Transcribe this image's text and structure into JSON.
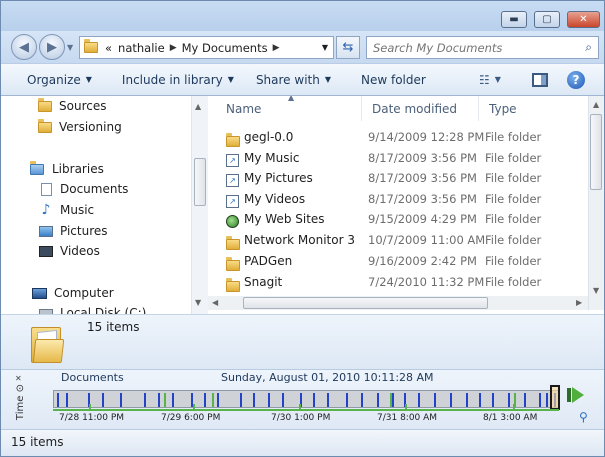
{
  "window": {
    "controls": {
      "minimize": "▬",
      "maximize": "▢",
      "close": "✕"
    }
  },
  "address": {
    "overflow": "«",
    "crumbs": [
      "nathalie",
      "My Documents"
    ],
    "search_placeholder": "Search My Documents"
  },
  "toolbar": {
    "organize": "Organize",
    "include_in_library": "Include in library",
    "share_with": "Share with",
    "new_folder": "New folder"
  },
  "nav": {
    "items": [
      {
        "label": "Sources",
        "icon": "folder-icon"
      },
      {
        "label": "Versioning",
        "icon": "folder-icon"
      },
      {
        "label": "Libraries",
        "icon": "library-icon"
      },
      {
        "label": "Documents",
        "icon": "documents-icon"
      },
      {
        "label": "Music",
        "icon": "music-icon"
      },
      {
        "label": "Pictures",
        "icon": "pictures-icon"
      },
      {
        "label": "Videos",
        "icon": "videos-icon"
      },
      {
        "label": "Computer",
        "icon": "computer-icon"
      },
      {
        "label": "Local Disk (C:)",
        "icon": "disk-icon"
      }
    ]
  },
  "columns": {
    "name": "Name",
    "date_modified": "Date modified",
    "type": "Type"
  },
  "files": [
    {
      "name": "gegl-0.0",
      "date": "9/14/2009 12:28 PM",
      "type": "File folder",
      "icon": "folder-icon"
    },
    {
      "name": "My Music",
      "date": "8/17/2009 3:56 PM",
      "type": "File folder",
      "icon": "shortcut-icon"
    },
    {
      "name": "My Pictures",
      "date": "8/17/2009 3:56 PM",
      "type": "File folder",
      "icon": "shortcut-icon"
    },
    {
      "name": "My Videos",
      "date": "8/17/2009 3:56 PM",
      "type": "File folder",
      "icon": "shortcut-icon"
    },
    {
      "name": "My Web Sites",
      "date": "9/15/2009 4:29 PM",
      "type": "File folder",
      "icon": "web-sites-icon"
    },
    {
      "name": "Network Monitor 3",
      "date": "10/7/2009 11:00 AM",
      "type": "File folder",
      "icon": "folder-icon"
    },
    {
      "name": "PADGen",
      "date": "9/16/2009 2:42 PM",
      "type": "File folder",
      "icon": "folder-icon"
    },
    {
      "name": "Snagit",
      "date": "7/24/2010 11:32 PM",
      "type": "File folder",
      "icon": "folder-icon"
    }
  ],
  "details": {
    "count": "15 items"
  },
  "timeline": {
    "side_label": "Time",
    "location": "Documents",
    "datetime": "Sunday, August 01, 2010 10:11:28 AM",
    "ticks": [
      "7/28 11:00 PM",
      "7/29 6:00 PM",
      "7/30 1:00 PM",
      "7/31 8:00 AM",
      "8/1 3:00 AM"
    ]
  },
  "status": {
    "count": "15 items"
  },
  "colors": {
    "timeline_tick": "#2443c6",
    "timeline_grid": "#58b34a",
    "toolbar_text": "#1e395b"
  }
}
